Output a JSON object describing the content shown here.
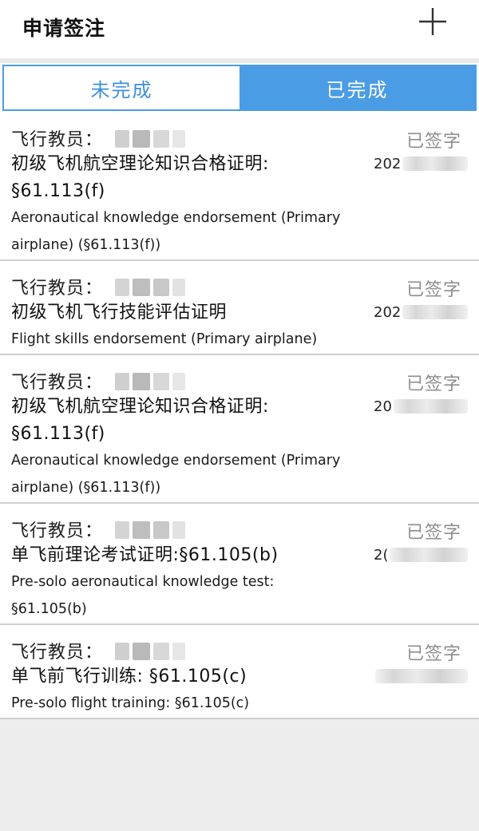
{
  "header": {
    "title": "申请签注",
    "add_icon": "plus-icon"
  },
  "tabs": [
    {
      "label": "未完成",
      "active": false
    },
    {
      "label": "已完成",
      "active": true
    }
  ],
  "colors": {
    "accent": "#4a9de4",
    "status_text": "#8e8e8e",
    "divider": "#cfcfcf"
  },
  "records": [
    {
      "instructor_label": "飞行教员：",
      "status": "已签字",
      "title_cn": [
        "初级飞机航空理论知识合格证明:",
        "§61.113(f)"
      ],
      "title_en": [
        "Aeronautical knowledge endorsement (Primary",
        "airplane) (§61.113(f))"
      ],
      "date_prefix": "202"
    },
    {
      "instructor_label": "飞行教员：",
      "status": "已签字",
      "title_cn": [
        "初级飞机飞行技能评估证明"
      ],
      "title_en": [
        "Flight skills endorsement (Primary airplane)"
      ],
      "date_prefix": "202"
    },
    {
      "instructor_label": "飞行教员：",
      "status": "已签字",
      "title_cn": [
        "初级飞机航空理论知识合格证明:",
        "§61.113(f)"
      ],
      "title_en": [
        "Aeronautical knowledge endorsement (Primary",
        "airplane) (§61.113(f))"
      ],
      "date_prefix": "20"
    },
    {
      "instructor_label": "飞行教员：",
      "status": "已签字",
      "title_cn": [
        "单飞前理论考试证明:§61.105(b)"
      ],
      "title_en": [
        "Pre-solo aeronautical knowledge test:",
        "§61.105(b)"
      ],
      "date_prefix": "2("
    },
    {
      "instructor_label": "飞行教员：",
      "status": "已签字",
      "title_cn": [
        "单飞前飞行训练: §61.105(c)"
      ],
      "title_en": [
        "Pre-solo flight training: §61.105(c)"
      ],
      "date_prefix": ""
    }
  ]
}
